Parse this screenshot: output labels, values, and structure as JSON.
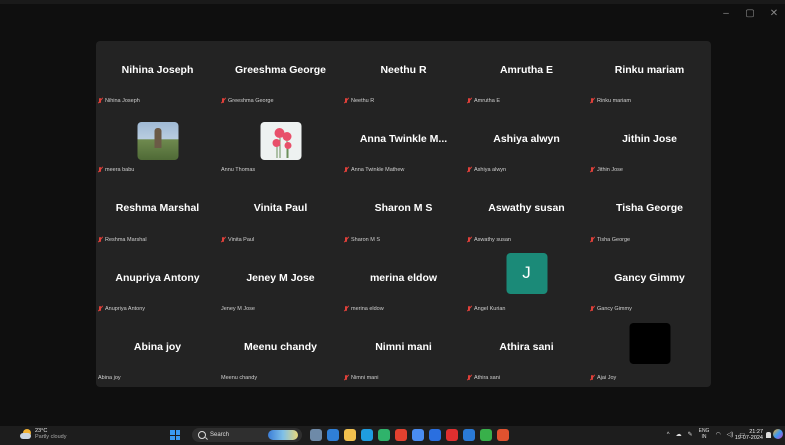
{
  "window": {
    "controls": [
      "–",
      "▢",
      "✕"
    ]
  },
  "participants": [
    {
      "display": "Nihina Joseph",
      "label": "Nihina Joseph",
      "muted": true,
      "kind": "name"
    },
    {
      "display": "Greeshma George",
      "label": "Greeshma George",
      "muted": true,
      "kind": "name"
    },
    {
      "display": "Neethu R",
      "label": "Neethu R",
      "muted": true,
      "kind": "name"
    },
    {
      "display": "Amrutha E",
      "label": "Amrutha E",
      "muted": true,
      "kind": "name"
    },
    {
      "display": "Rinku mariam",
      "label": "Rinku mariam",
      "muted": true,
      "kind": "name"
    },
    {
      "display": "",
      "label": "meera babu",
      "muted": true,
      "kind": "photo-landscape"
    },
    {
      "display": "",
      "label": "Annu Thomas",
      "muted": false,
      "kind": "photo-flower"
    },
    {
      "display": "Anna Twinkle M...",
      "label": "Anna Twinkle Mathew",
      "muted": true,
      "kind": "name"
    },
    {
      "display": "Ashiya alwyn",
      "label": "Ashiya alwyn",
      "muted": true,
      "kind": "name"
    },
    {
      "display": "Jithin Jose",
      "label": "Jithin Jose",
      "muted": true,
      "kind": "name"
    },
    {
      "display": "Reshma Marshal",
      "label": "Reshma Marshal",
      "muted": true,
      "kind": "name"
    },
    {
      "display": "Vinita Paul",
      "label": "Vinita Paul",
      "muted": true,
      "kind": "name"
    },
    {
      "display": "Sharon M S",
      "label": "Sharon M S",
      "muted": true,
      "kind": "name"
    },
    {
      "display": "Aswathy susan",
      "label": "Aswathy susan",
      "muted": true,
      "kind": "name"
    },
    {
      "display": "Tisha George",
      "label": "Tisha George",
      "muted": true,
      "kind": "name"
    },
    {
      "display": "Anupriya Antony",
      "label": "Anupriya Antony",
      "muted": true,
      "kind": "name"
    },
    {
      "display": "Jeney M Jose",
      "label": "Jeney M Jose",
      "muted": false,
      "kind": "name"
    },
    {
      "display": "merina eldow",
      "label": "merina eldow",
      "muted": true,
      "kind": "name"
    },
    {
      "display": "J",
      "label": "Angel Kurian",
      "muted": true,
      "kind": "avatar-letter"
    },
    {
      "display": "Gancy Gimmy",
      "label": "Gancy Gimmy",
      "muted": true,
      "kind": "name"
    },
    {
      "display": "Abina joy",
      "label": "Abina joy",
      "muted": false,
      "kind": "name"
    },
    {
      "display": "Meenu chandy",
      "label": "Meenu chandy",
      "muted": false,
      "kind": "name"
    },
    {
      "display": "Nimni mani",
      "label": "Nimni mani",
      "muted": true,
      "kind": "name"
    },
    {
      "display": "Athira sani",
      "label": "Athira sani",
      "muted": true,
      "kind": "name"
    },
    {
      "display": "",
      "label": "Ajai Joy",
      "muted": true,
      "kind": "avatar-black"
    }
  ],
  "taskbar": {
    "weather_temp": "23°C",
    "weather_desc": "Partly cloudy",
    "search_placeholder": "Search",
    "lang_top": "ENG",
    "lang_bottom": "IN",
    "time": "21:27",
    "date": "19-07-2024",
    "app_colors": [
      "#6e8aa8",
      "#2f7fd6",
      "#f2c14e",
      "#1f9de0",
      "#2fb36b",
      "#e3412f",
      "#4a8df2",
      "#2a6fe0",
      "#e02f2f",
      "#2a7ad6",
      "#38b04a",
      "#e0522f"
    ]
  }
}
